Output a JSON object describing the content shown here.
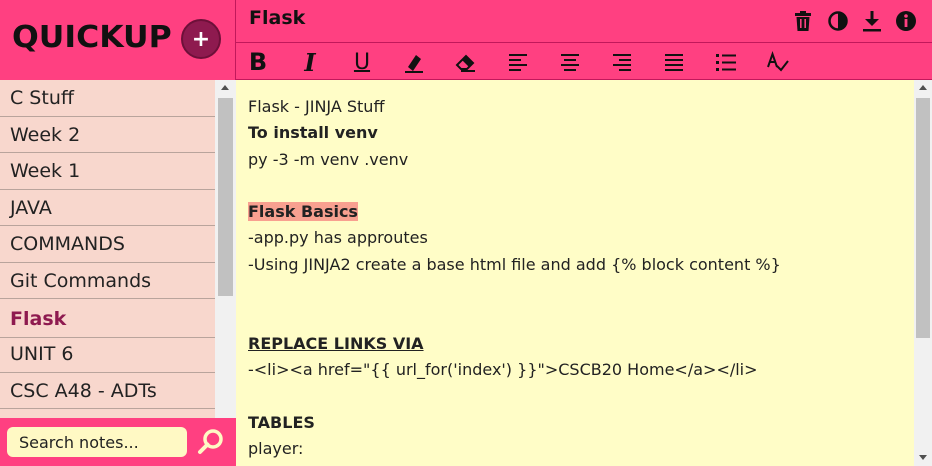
{
  "app": {
    "logo": "QUICKUP",
    "add_label": "+"
  },
  "colors": {
    "accent": "#ff4081",
    "sidebar_bg": "#f8d7cd",
    "editor_bg": "#fffdc7",
    "active_note": "#8e1a4f",
    "highlight": "#f8a090"
  },
  "notes": [
    {
      "label": "C Stuff"
    },
    {
      "label": "Week 2"
    },
    {
      "label": "Week 1"
    },
    {
      "label": "JAVA"
    },
    {
      "label": "COMMANDS"
    },
    {
      "label": "Git Commands"
    },
    {
      "label": "Flask",
      "active": true
    },
    {
      "label": "UNIT 6"
    },
    {
      "label": "CSC A48 - ADTs"
    }
  ],
  "search": {
    "placeholder": "Search notes...",
    "icon": "search-icon"
  },
  "header": {
    "title": "Flask",
    "icons": [
      "trash-icon",
      "contrast-icon",
      "download-icon",
      "info-icon"
    ]
  },
  "toolbar": {
    "bold": "B",
    "italic": "I",
    "underline": "U",
    "icons": [
      "highlighter-icon",
      "eraser-icon",
      "align-left-icon",
      "align-center-icon",
      "align-right-icon",
      "align-justify-icon",
      "bullet-list-icon",
      "spellcheck-icon"
    ]
  },
  "editor": {
    "lines": [
      {
        "text": "Flask - JINJA Stuff",
        "style": "normal"
      },
      {
        "text": "To install venv",
        "style": "bold"
      },
      {
        "text": "py -3 -m venv .venv",
        "style": "normal"
      },
      {
        "text": "",
        "style": "normal"
      },
      {
        "text": "Flask Basics",
        "style": "highlight"
      },
      {
        "text": "-app.py has approutes",
        "style": "normal"
      },
      {
        "text": "-Using JINJA2 create a base html file and add {% block content %}",
        "style": "normal"
      },
      {
        "text": "",
        "style": "normal"
      },
      {
        "text": "",
        "style": "normal"
      },
      {
        "text": "REPLACE LINKS VIA",
        "style": "underline"
      },
      {
        "text": "-<li><a href=\"{{ url_for('index') }}\">CSCB20 Home</a></li>",
        "style": "normal"
      },
      {
        "text": "",
        "style": "normal"
      },
      {
        "text": "TABLES",
        "style": "bold"
      },
      {
        "text": "player:",
        "style": "normal"
      }
    ]
  }
}
